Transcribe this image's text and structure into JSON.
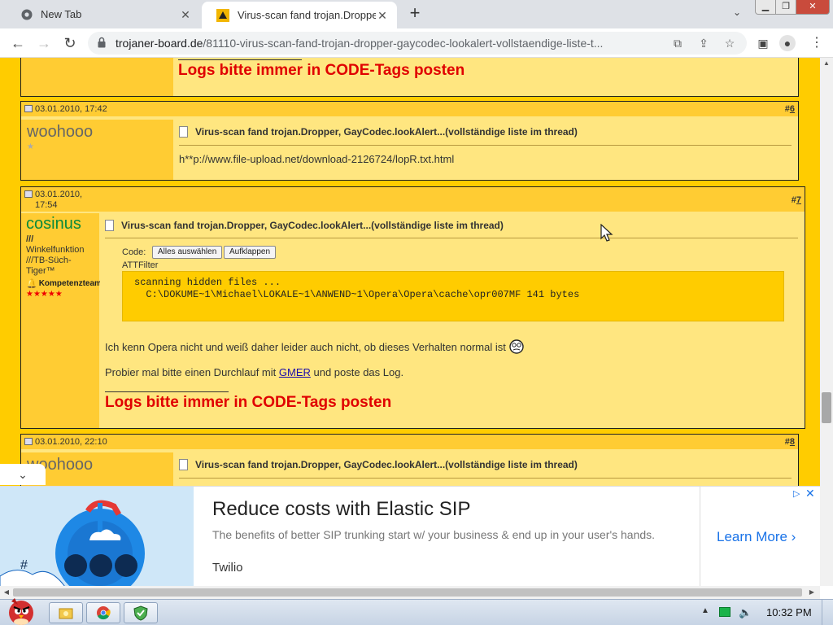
{
  "browser": {
    "tabs": [
      {
        "title": "New Tab",
        "active": false,
        "icon": "chrome-icon"
      },
      {
        "title": "Virus-scan fand trojan.Dropper",
        "active": true,
        "icon": "forum-icon"
      }
    ],
    "url_host": "trojaner-board.de",
    "url_path": "/81110-virus-scan-fand-trojan-dropper-gaycodec-lookalert-vollstaendige-liste-t..."
  },
  "page": {
    "prev_post": {
      "signature": "Logs bitte immer in CODE-Tags posten"
    },
    "posts": [
      {
        "date": "03.01.2010, 17:42",
        "number_prefix": "#",
        "number": "6",
        "username": "woohooo",
        "title": "Virus-scan fand trojan.Dropper, GayCodec.lookAlert...(vollständige liste im thread)",
        "body": "h**p://www.file-upload.net/download-2126724/lopR.txt.html"
      },
      {
        "date": "03.01.2010,\n17:54",
        "number_prefix": "#",
        "number": "7",
        "username": "cosinus",
        "user_line1": "///",
        "user_line2": "Winkelfunktion",
        "user_line3": "///TB-Süch-",
        "user_line4": "Tiger™",
        "user_badge": "Kompetenzteam",
        "title": "Virus-scan fand trojan.Dropper, GayCodec.lookAlert...(vollständige liste im thread)",
        "code_label": "Code:",
        "select_all": "Alles auswählen",
        "expand": "Aufklappen",
        "code_caption": "ATTFilter",
        "code_text": "scanning hidden files ...\n  C:\\DOKUME~1\\Michael\\LOKALE~1\\ANWEND~1\\Opera\\Opera\\cache\\opr007MF 141 bytes",
        "body1": "Ich kenn Opera nicht und weiß daher leider auch nicht, ob dieses Verhalten normal ist",
        "body2_pre": "Probier mal bitte einen Durchlauf mit ",
        "body2_link": "GMER",
        "body2_post": " und poste das Log.",
        "signature": "Logs bitte immer in CODE-Tags posten"
      },
      {
        "date": "03.01.2010, 22:10",
        "number_prefix": "#",
        "number": "8",
        "username": "woohooo",
        "title": "Virus-scan fand trojan.Dropper, GayCodec.lookAlert...(vollständige liste im thread)"
      }
    ]
  },
  "ad": {
    "title": "Reduce costs with Elastic SIP",
    "description": "The benefits of better SIP trunking start w/ your business & end up in your user's hands.",
    "brand": "Twilio",
    "cta": "Learn More",
    "image_glyph": "#"
  },
  "taskbar": {
    "time": "10:32 PM"
  },
  "colors": {
    "page_bg": "#ffcc00",
    "post_bg": "#ffe680",
    "signature": "#e00000",
    "username_green": "#0a8a3a"
  }
}
